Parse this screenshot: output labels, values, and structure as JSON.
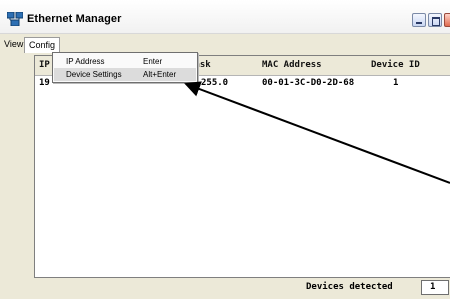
{
  "window": {
    "title": "Ethernet Manager",
    "controls": [
      "minimize",
      "maximize",
      "close"
    ]
  },
  "menubar": {
    "items": [
      {
        "label": "View"
      },
      {
        "label": "Config"
      }
    ]
  },
  "config_menu": {
    "items": [
      {
        "label": "IP Address",
        "shortcut": "Enter"
      },
      {
        "label": "Device Settings",
        "shortcut": "Alt+Enter"
      }
    ]
  },
  "table": {
    "headers": {
      "ip": "IP",
      "mask": "Mask",
      "mac": "MAC Address",
      "device_id": "Device ID"
    },
    "rows": [
      {
        "ip": "19",
        "mask": "255.0",
        "mac": "00-01-3C-D0-2D-68",
        "device_id": "1"
      }
    ]
  },
  "status": {
    "label": "Devices detected",
    "count": "1"
  },
  "colors": {
    "window_bg": "#ece9d8",
    "list_bg": "#ffffff",
    "highlight": "#dcdcdc",
    "text": "#000000"
  },
  "icons": {
    "app": "network-icon",
    "arrow": "callout-arrow"
  }
}
